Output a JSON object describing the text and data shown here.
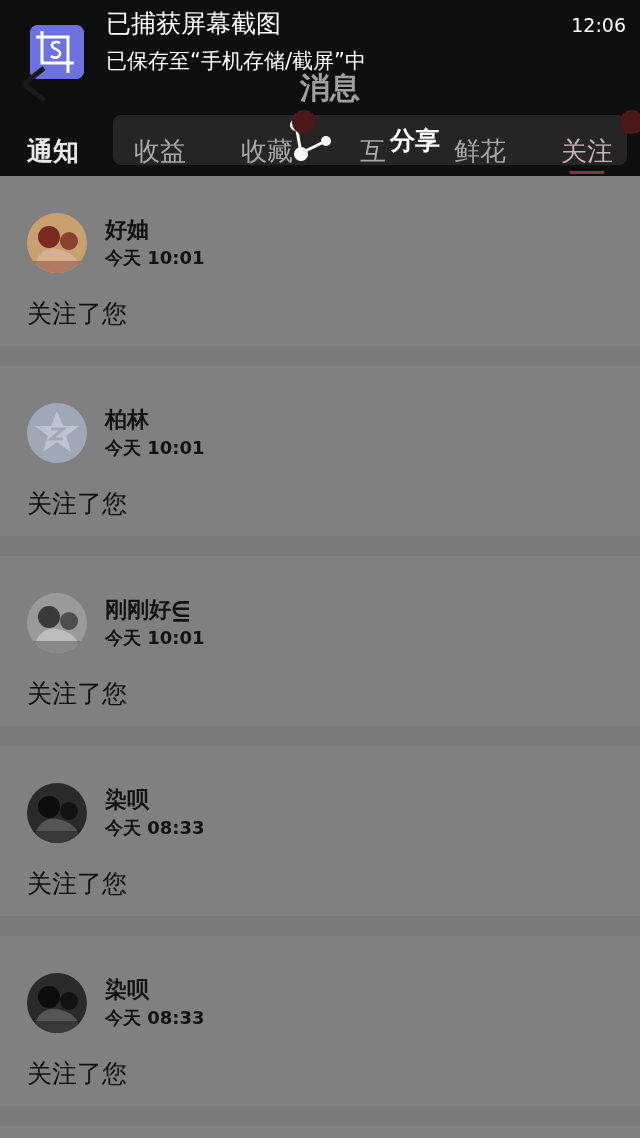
{
  "notification": {
    "title": "已捕获屏幕截图",
    "message": "已保存至“手机存储/截屏”中",
    "time": "12:06",
    "action": "分享"
  },
  "header": {
    "title": "消息"
  },
  "tabs": [
    {
      "label": "通知",
      "selected": false
    },
    {
      "label": "收益",
      "selected": false
    },
    {
      "label": "收藏",
      "selected": false
    },
    {
      "label": "互",
      "selected": false
    },
    {
      "label": "鲜花",
      "selected": false
    },
    {
      "label": "关注",
      "selected": true
    }
  ],
  "messages": [
    {
      "name": "好妯",
      "time": "今天 10:01",
      "text": "关注了您"
    },
    {
      "name": "柏林",
      "time": "今天 10:01",
      "text": "关注了您",
      "avatar": {
        "kind": "default"
      }
    },
    {
      "name": "刚刚好⋸",
      "time": "今天 10:01",
      "text": "关注了您"
    },
    {
      "name": "染呗",
      "time": "今天 08:33",
      "text": "关注了您"
    },
    {
      "name": "染呗",
      "time": "今天 08:33",
      "text": "关注了您"
    }
  ]
}
